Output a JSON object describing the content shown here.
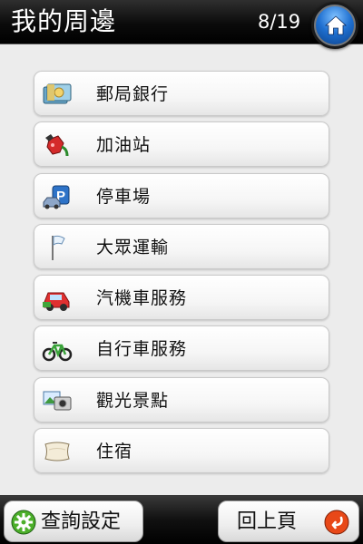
{
  "header": {
    "title": "我的周邊",
    "counter": "8/19",
    "home_icon": "home-icon"
  },
  "categories": [
    {
      "label": "郵局銀行",
      "icon": "bank-money-icon"
    },
    {
      "label": "加油站",
      "icon": "gas-pump-icon"
    },
    {
      "label": "停車場",
      "icon": "parking-icon"
    },
    {
      "label": "大眾運輸",
      "icon": "flag-icon"
    },
    {
      "label": "汽機車服務",
      "icon": "car-service-icon"
    },
    {
      "label": "自行車服務",
      "icon": "bicycle-icon"
    },
    {
      "label": "觀光景點",
      "icon": "photo-camera-icon"
    },
    {
      "label": "住宿",
      "icon": "pillow-icon"
    }
  ],
  "footer": {
    "settings_label": "查詢設定",
    "back_label": "回上頁"
  },
  "colors": {
    "header_bg": "#000000",
    "home_button": "#1e6fd0",
    "back_icon": "#e84818",
    "settings_icon": "#4caf2a"
  }
}
